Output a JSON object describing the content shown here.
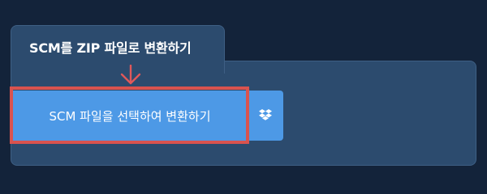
{
  "tab": {
    "title": "SCM를 ZIP 파일로 변환하기"
  },
  "convert": {
    "button_label": "SCM 파일을 선택하여 변환하기"
  },
  "icons": {
    "arrow": "arrow-down-icon",
    "dropbox": "dropbox-icon"
  },
  "colors": {
    "background": "#13233a",
    "panel": "#2c4b6e",
    "button": "#4d99e6",
    "highlight": "#d9534f"
  }
}
